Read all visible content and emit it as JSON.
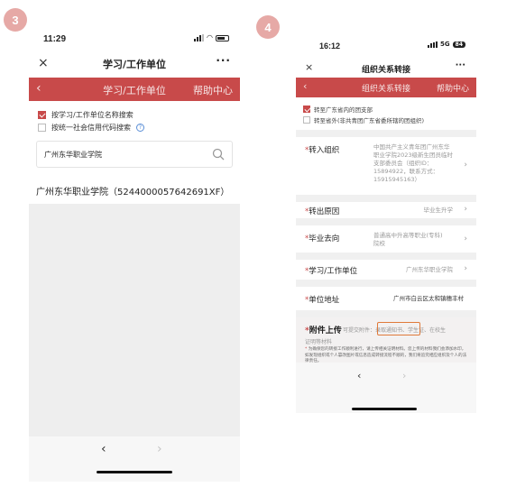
{
  "step_labels": [
    "3",
    "4"
  ],
  "phone1": {
    "status_time": "11:29",
    "title": "学习/工作单位",
    "more": "···",
    "red_title": "学习/工作单位",
    "help": "帮助中心",
    "options": [
      {
        "label": "按学习/工作单位名称搜索",
        "checked": true
      },
      {
        "label": "按统一社会信用代码搜索",
        "checked": false
      }
    ],
    "search_value": "广州东华职业学院",
    "result": "广州东华职业学院（5244000057642691XF）"
  },
  "phone2": {
    "status_time": "16:12",
    "status_network": "5G",
    "status_battery": "84",
    "title": "组织关系转接",
    "more": "···",
    "red_title": "组织关系转接",
    "help": "帮助中心",
    "options": [
      {
        "label": "转至广东省内的团支部",
        "checked": true
      },
      {
        "label": "转至省外(非共青团广东省委所辖的团组织)",
        "checked": false
      }
    ],
    "rows": {
      "org_label": "转入组织",
      "org_value": "中国共产主义青年团广州东华职业学院2023级新生团员临时支部委员会（组织ID：15894922，联系方式：15915945163）",
      "reason_label": "转出原因",
      "reason_value": "毕业生升学",
      "destination_label": "毕业去向",
      "destination_value": "普通高中升高等职业(专科)院校",
      "unit_label": "学习/工作单位",
      "unit_value": "广州东华职业学院",
      "address_label": "单位地址",
      "address_value": "广州市白云区太和镇穗丰村"
    },
    "attachment": {
      "title": "附件上传",
      "hint_a": "可提交附件：",
      "hint_highlight": "录取通知书、",
      "hint_b": "学生证、在校生",
      "hint_c": "证明等材料",
      "note": "为确保您的转接工作顺利进行，请上传相关证明材料。您上传的材料我们会添加水印，如发现组织或个人篡改图片或信息造成转接流程不顺的，我们将追究相应组织及个人的法律责任。"
    }
  },
  "icons": {
    "close": "×",
    "back": "‹",
    "prev": "‹",
    "next": "›",
    "chevron": "›",
    "help_circle": "?"
  },
  "colors": {
    "red_bar": "#c84a4a",
    "step_badge": "#e6a9a6",
    "highlight_box": "#e07a3a",
    "help_blue": "#5b8fd6"
  }
}
